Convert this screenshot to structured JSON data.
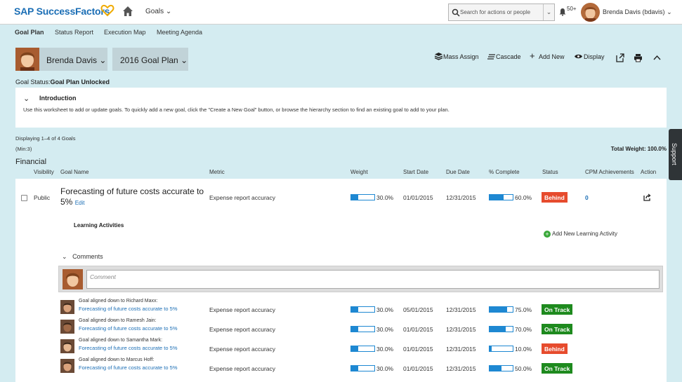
{
  "header": {
    "logo": "SAP SuccessFactors",
    "goals_menu": "Goals",
    "search_placeholder": "Search for actions or people",
    "notification_count": "50+",
    "user_name": "Brenda Davis (bdavis)"
  },
  "tabs": [
    "Goal Plan",
    "Status Report",
    "Execution Map",
    "Meeting Agenda"
  ],
  "plan": {
    "person": "Brenda Davis",
    "plan_name": "2016 Goal Plan",
    "toolbar": {
      "mass_assign": "Mass Assign",
      "cascade": "Cascade",
      "add_new": "Add New",
      "display": "Display"
    },
    "goal_status_label": "Goal Status:",
    "goal_status_value": "Goal Plan Unlocked"
  },
  "intro": {
    "title": "Introduction",
    "text": "Use this worksheet to add or update goals. To quickly add a new goal, click the \"Create a New Goal\" button, or browse the hierarchy section to find an existing goal to add to your plan."
  },
  "list": {
    "displaying": "Displaying 1–4 of 4 Goals",
    "min": "(Min:3)",
    "total_weight": "Total Weight: 100.0%",
    "section": "Financial",
    "columns": [
      "Visibility",
      "Goal Name",
      "Metric",
      "Weight",
      "Start Date",
      "Due Date",
      "% Complete",
      "Status",
      "CPM Achievements",
      "Action"
    ]
  },
  "goal": {
    "visibility": "Public",
    "name": "Forecasting of future costs accurate to 5%",
    "edit": "Edit",
    "metric": "Expense report accuracy",
    "weight": "30.0%",
    "weight_fraction": 0.3,
    "start": "01/01/2015",
    "due": "12/31/2015",
    "complete": "60.0%",
    "complete_fraction": 0.6,
    "status": "Behind",
    "cpm": "0",
    "learning_title": "Learning Activities",
    "add_learning": "Add New Learning Activity",
    "comments_label": "Comments",
    "comment_placeholder": "Comment"
  },
  "subgoals": [
    {
      "aligned": "Goal aligned down to Richard Maxx:",
      "goal": "Forecasting of future costs accurate to 5%",
      "metric": "Expense report accuracy",
      "weight": "30.0%",
      "weight_fraction": 0.3,
      "start": "05/01/2015",
      "due": "12/31/2015",
      "complete": "75.0%",
      "complete_fraction": 0.75,
      "status": "On Track"
    },
    {
      "aligned": "Goal aligned down to Ramesh Jain:",
      "goal": "Forecasting of future costs accurate to 5%",
      "metric": "Expense report accuracy",
      "weight": "30.0%",
      "weight_fraction": 0.3,
      "start": "01/01/2015",
      "due": "12/31/2015",
      "complete": "70.0%",
      "complete_fraction": 0.7,
      "status": "On Track"
    },
    {
      "aligned": "Goal aligned down to Samantha Mark:",
      "goal": "Forecasting of future costs accurate to 5%",
      "metric": "Expense report accuracy",
      "weight": "30.0%",
      "weight_fraction": 0.3,
      "start": "01/01/2015",
      "due": "12/31/2015",
      "complete": "10.0%",
      "complete_fraction": 0.1,
      "status": "Behind"
    },
    {
      "aligned": "Goal aligned down to Marcus Hoff:",
      "goal": "Forecasting of future costs accurate to 5%",
      "metric": "Expense report accuracy",
      "weight": "30.0%",
      "weight_fraction": 0.3,
      "start": "01/01/2015",
      "due": "12/31/2015",
      "complete": "50.0%",
      "complete_fraction": 0.5,
      "status": "On Track"
    }
  ],
  "support": "Support",
  "colors": {
    "brand": "#1b6eb5",
    "behind": "#e64b2d",
    "on_track": "#1e8a1e",
    "bar": "#1e88d2",
    "background": "#d4ecf1"
  }
}
